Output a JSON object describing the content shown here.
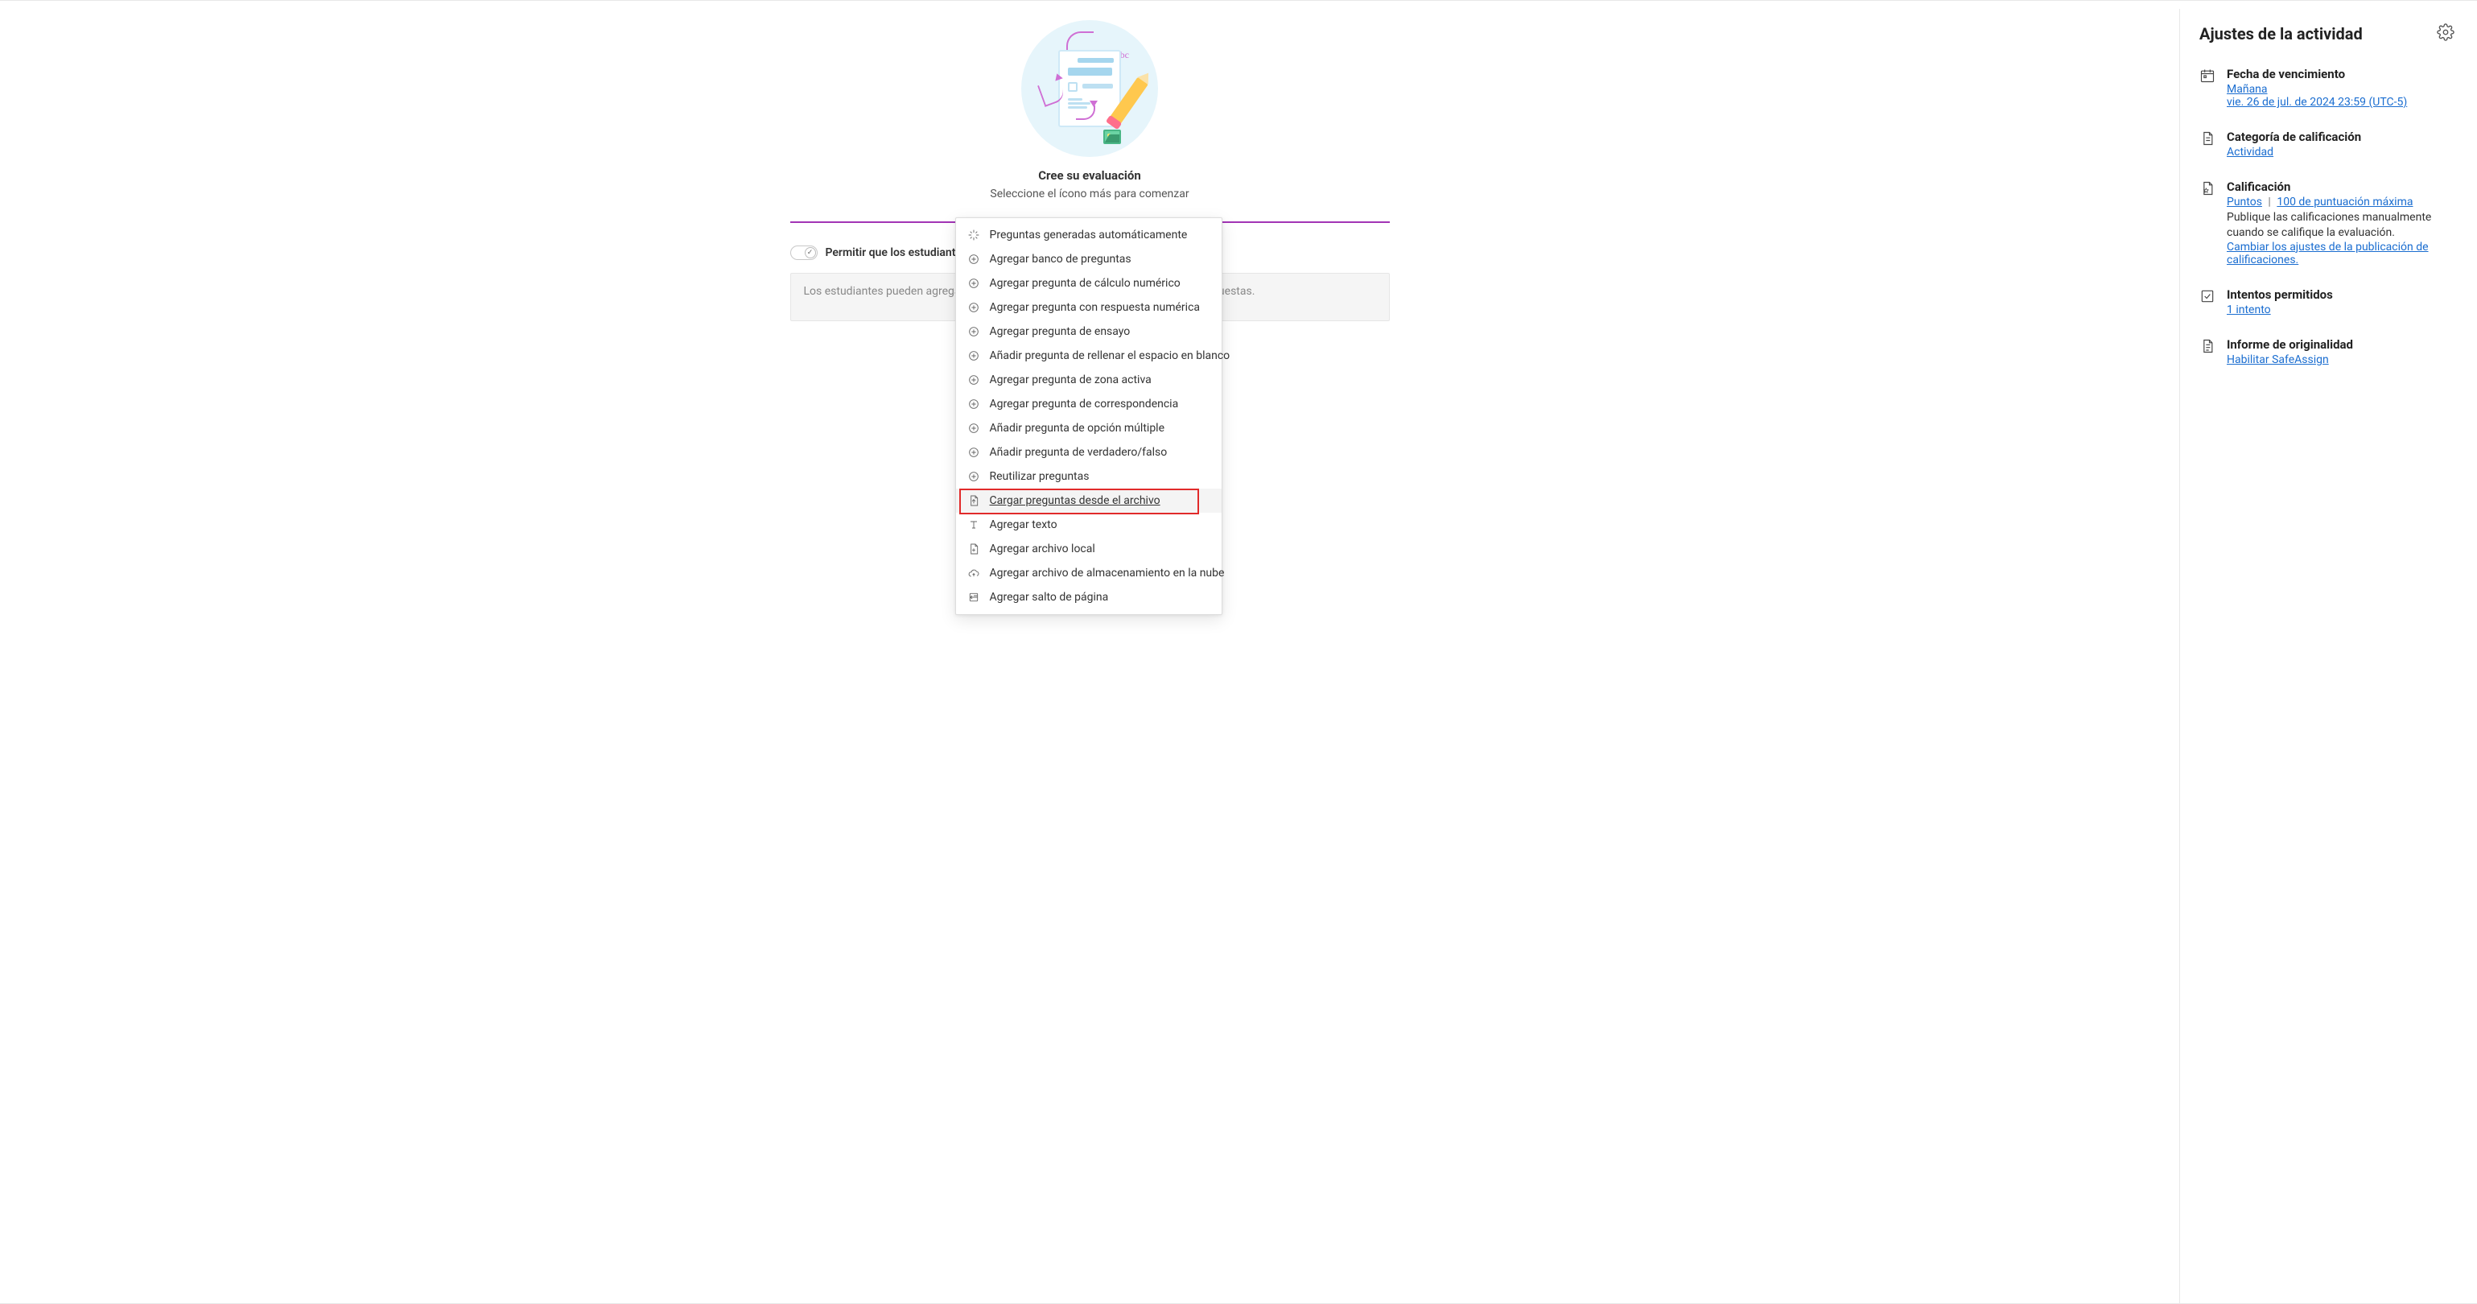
{
  "hero": {
    "title": "Cree su evaluación",
    "subtitle": "Seleccione el ícono más para comenzar",
    "abc": "Abc"
  },
  "toggle": {
    "label": "Permitir que los estudiantes agreguen contenido al final de la evaluación",
    "checked": true
  },
  "textarea": {
    "placeholder": "Los estudiantes pueden agregar texto, imágenes y archivos que respalden sus respuestas."
  },
  "menu": {
    "items": [
      {
        "id": "auto",
        "icon": "sparkle",
        "label": "Preguntas generadas automáticamente"
      },
      {
        "id": "bank",
        "icon": "plus-circle",
        "label": "Agregar banco de preguntas"
      },
      {
        "id": "numcalc",
        "icon": "plus-circle",
        "label": "Agregar pregunta de cálculo numérico"
      },
      {
        "id": "numresp",
        "icon": "plus-circle",
        "label": "Agregar pregunta con respuesta numérica"
      },
      {
        "id": "essay",
        "icon": "plus-circle",
        "label": "Agregar pregunta de ensayo"
      },
      {
        "id": "fillblank",
        "icon": "plus-circle",
        "label": "Añadir pregunta de rellenar el espacio en blanco"
      },
      {
        "id": "hotspot",
        "icon": "plus-circle",
        "label": "Agregar pregunta de zona activa"
      },
      {
        "id": "match",
        "icon": "plus-circle",
        "label": "Agregar pregunta de correspondencia"
      },
      {
        "id": "multi",
        "icon": "plus-circle",
        "label": "Añadir pregunta de opción múltiple"
      },
      {
        "id": "tf",
        "icon": "plus-circle",
        "label": "Añadir pregunta de verdadero/falso"
      },
      {
        "id": "reuse",
        "icon": "plus-circle",
        "label": "Reutilizar preguntas"
      },
      {
        "id": "upload",
        "icon": "file-up",
        "label": "Cargar preguntas desde el archivo",
        "hovered": true
      },
      {
        "id": "text",
        "icon": "text",
        "label": "Agregar texto"
      },
      {
        "id": "localfile",
        "icon": "file-plus",
        "label": "Agregar archivo local"
      },
      {
        "id": "cloudfile",
        "icon": "cloud",
        "label": "Agregar archivo de almacenamiento en la nube"
      },
      {
        "id": "pagebreak",
        "icon": "page-break",
        "label": "Agregar salto de página"
      }
    ]
  },
  "sidebar": {
    "title": "Ajustes de la actividad",
    "due": {
      "label": "Fecha de vencimiento",
      "relative": "Mañana",
      "full": "vie. 26 de jul. de 2024 23:59 (UTC-5)"
    },
    "grade_category": {
      "label": "Categoría de calificación",
      "value": "Actividad"
    },
    "grading": {
      "label": "Calificación",
      "points": "Puntos",
      "max": "100 de puntuación máxima",
      "note": "Publique las calificaciones manualmente cuando se califique la evaluación.",
      "change_link": "Cambiar los ajustes de la publicación de calificaciones."
    },
    "attempts": {
      "label": "Intentos permitidos",
      "value": "1 intento"
    },
    "originality": {
      "label": "Informe de originalidad",
      "value": "Habilitar SafeAssign"
    }
  }
}
